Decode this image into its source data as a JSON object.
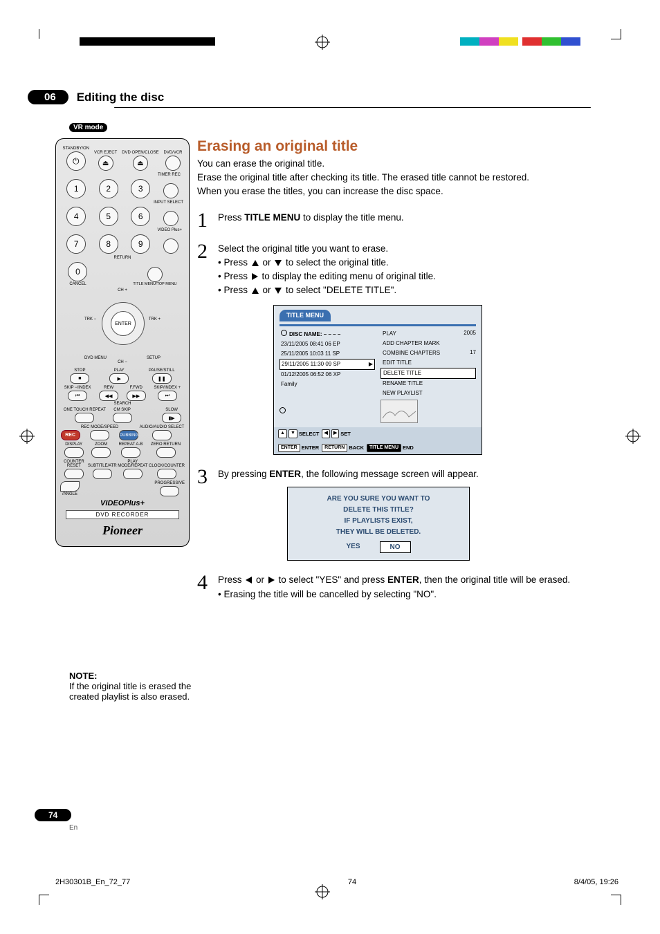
{
  "printmarks": {
    "top_black_bars": true,
    "colors": [
      "#e03030",
      "#30c030",
      "#3050d0",
      "#00b0c0",
      "#d040c0",
      "#f0e020"
    ]
  },
  "chapter": {
    "number": "06",
    "title": "Editing the disc"
  },
  "mode_badge": "VR mode",
  "remote": {
    "labels": {
      "standby": "STANDBY/ON",
      "vcr_eject": "VCR EJECT",
      "dvd_oc": "DVD OPEN/CLOSE",
      "dvd_vcr": "DVD/VCR",
      "timer": "TIMER REC",
      "input": "INPUT SELECT",
      "video_plus": "VIDEO Plus+",
      "return": "RETURN",
      "cancel": "CANCEL",
      "title_menu": "TITLE MENU/TOP MENU",
      "ch_up": "CH +",
      "ch_down": "CH −",
      "trk_minus": "TRK −",
      "trk_plus": "TRK +",
      "enter": "ENTER",
      "dvd_menu": "DVD MENU",
      "setup": "SETUP",
      "stop": "STOP",
      "play": "PLAY",
      "pause": "PAUSE/STILL",
      "skip_m": "SKIP −/INDEX",
      "rew": "REW",
      "search": "SEARCH",
      "ffwd": "F.FWD",
      "skip_p": "SKIP/INDEX +",
      "onetouch": "ONE TOUCH REPEAT",
      "cmskip": "CM SKIP",
      "slow": "SLOW",
      "rec": "REC",
      "recmode": "REC MODE/SPEED",
      "dubbing": "DUBBING",
      "audio": "AUDIO/AUDIO SELECT",
      "display": "DISPLAY",
      "zoom": "ZOOM",
      "repeatab": "REPEAT A-B",
      "zeroreturn": "ZERO RETURN",
      "counter": "COUNTER RESET",
      "subtitle": "SUBTITLE/ATR",
      "playmode": "PLAY MODE/REPEAT",
      "clock": "CLOCK/COUNTER",
      "angle": "/ANGLE",
      "progressive": "PROGRESSIVE",
      "videoplus_logo": "VIDEOPlus+",
      "dvd_recorder": "DVD RECORDER",
      "brand": "Pioneer"
    },
    "digits": [
      "1",
      "2",
      "3",
      "4",
      "5",
      "6",
      "7",
      "8",
      "9",
      "0"
    ]
  },
  "section": {
    "title": "Erasing an original title",
    "intro": [
      "You can erase the original title.",
      "Erase the original title after checking its title. The erased title cannot be restored.",
      "When you erase the titles, you can increase the disc space."
    ]
  },
  "steps": {
    "s1": {
      "pre": "Press ",
      "bold": "TITLE MENU",
      "post": " to display the title menu."
    },
    "s2": {
      "line": "Select the original title you want to erase.",
      "b1a": "Press ",
      "b1b": " or ",
      "b1c": " to select the original title.",
      "b2a": "Press ",
      "b2b": " to display the editing menu of original title.",
      "b3a": "Press ",
      "b3b": " or ",
      "b3c": " to select \"DELETE TITLE\"."
    },
    "s3": {
      "pre": "By pressing ",
      "bold": "ENTER",
      "post": ", the following message screen will appear."
    },
    "s4": {
      "pre": "Press ",
      "mid": " or ",
      "mid2": " to select \"YES\" and press ",
      "bold": "ENTER",
      "post": ", then the original title will be erased.",
      "bullet": "Erasing the title will be cancelled by selecting \"NO\"."
    }
  },
  "osd": {
    "title": "TITLE MENU",
    "disc_name_label": "DISC NAME:",
    "disc_name_value": "– – – –",
    "rows": [
      "23/11/2005 08:41 06 EP",
      "25/11/2005 10:03 11 SP",
      "29/11/2005 11:30 09 SP",
      "01/12/2005 06:52 06 XP",
      "Family"
    ],
    "selected_row_index": 2,
    "menu": [
      "PLAY",
      "ADD CHAPTER MARK",
      "COMBINE CHAPTERS",
      "EDIT TITLE",
      "DELETE TITLE",
      "RENAME TITLE",
      "NEW PLAYLIST"
    ],
    "selected_menu_index": 4,
    "right_meta": [
      "2005",
      "17"
    ],
    "footer": {
      "select": "SELECT",
      "set": "SET",
      "enter": "ENTER",
      "enter2": "ENTER",
      "return": "RETURN",
      "back": "BACK",
      "title_menu": "TITLE MENU",
      "end": "END"
    }
  },
  "dialog": {
    "lines": [
      "ARE YOU SURE YOU WANT TO",
      "DELETE THIS TITLE?",
      "IF PLAYLISTS EXIST,",
      "THEY WILL BE DELETED."
    ],
    "yes": "YES",
    "no": "NO"
  },
  "note": {
    "label": "NOTE:",
    "text": "If the original title is erased the created playlist is also erased."
  },
  "pagination": {
    "num": "74",
    "lang": "En"
  },
  "footer": {
    "left": "2H30301B_En_72_77",
    "center": "74",
    "right": "8/4/05, 19:26"
  }
}
